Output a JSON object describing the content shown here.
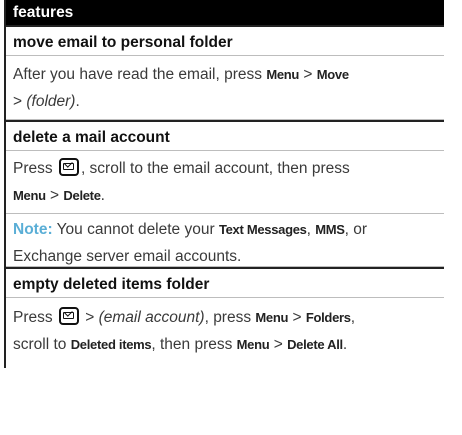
{
  "header": {
    "title": "features"
  },
  "sections": [
    {
      "title": "move email to personal folder",
      "p1": {
        "t1": "After you have read the email, press ",
        "k1": "Menu",
        "t2": " > ",
        "k2": "Move",
        "t3": " > ",
        "i1": "(folder)",
        "t4": "."
      }
    },
    {
      "title": "delete a mail account",
      "p1": {
        "t1": "Press ",
        "t2": ", scroll to the email account, then press ",
        "k1": "Menu",
        "t3": " > ",
        "k2": "Delete",
        "t4": "."
      },
      "note": {
        "label": "Note:",
        "t1": " You cannot delete your ",
        "k1": "Text Messages",
        "t2": ", ",
        "k2": "MMS",
        "t3": ", or Exchange server email accounts."
      }
    },
    {
      "title": "empty deleted items folder",
      "p1": {
        "t1": "Press ",
        "t2": " > ",
        "i1": "(email account)",
        "t3": ", press ",
        "k1": "Menu",
        "t4": " > ",
        "k2": "Folders",
        "t5": ",",
        "t6": "scroll to ",
        "k3": "Deleted items",
        "t7": ", then press ",
        "k4": "Menu",
        "t8": " > ",
        "k5": "Delete All",
        "t9": "."
      }
    }
  ],
  "icons": {
    "message_key": "message-key-icon"
  }
}
